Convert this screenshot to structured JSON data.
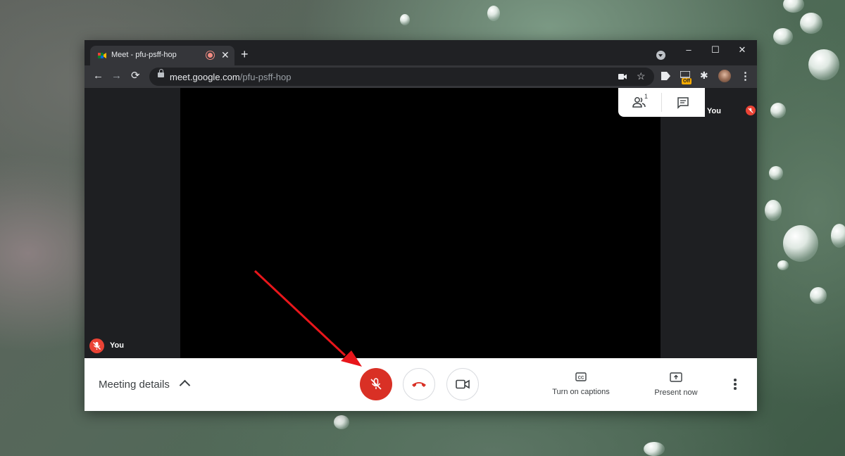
{
  "browser": {
    "tab": {
      "title": "Meet - pfu-psff-hop",
      "favicon": "google-meet-icon"
    },
    "new_tab": "+",
    "window_controls": {
      "minimize": "–",
      "maximize": "☐",
      "close": "✕"
    },
    "toolbar": {
      "back": "←",
      "forward": "→",
      "reload": "⟳"
    },
    "url": {
      "host": "meet.google.com",
      "path": "/pfu-psff-hop"
    },
    "extension_badge": "Off"
  },
  "meet": {
    "self_tile_name": "You",
    "sidebar_tile_name": "You",
    "people_count": "1",
    "bottom_bar": {
      "meeting_details": "Meeting details",
      "captions_label": "Turn on captions",
      "present_label": "Present now"
    },
    "mic_state": "muted"
  },
  "colors": {
    "hangup": "#d93025",
    "mic_muted": "#ea4335",
    "annotation_arrow": "#e8161b"
  }
}
